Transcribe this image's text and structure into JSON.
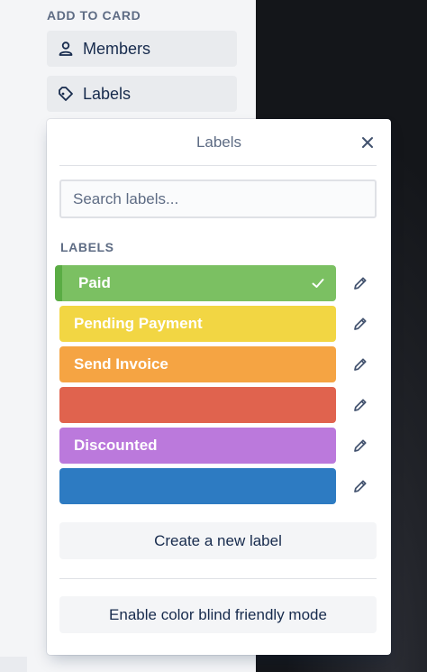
{
  "sidebar": {
    "section_title": "ADD TO CARD",
    "members_label": "Members",
    "members_icon": "person-icon",
    "labels_label": "Labels",
    "labels_icon": "tag-icon"
  },
  "popover": {
    "title": "Labels",
    "close_icon": "close-icon",
    "search_placeholder": "Search labels...",
    "section_heading": "LABELS",
    "labels": [
      {
        "name": "Paid",
        "color": "#7bc062",
        "selected": true
      },
      {
        "name": "Pending Payment",
        "color": "#f2d643",
        "selected": false
      },
      {
        "name": "Send Invoice",
        "color": "#f5a443",
        "selected": false
      },
      {
        "name": "",
        "color": "#e0634e",
        "selected": false
      },
      {
        "name": "Discounted",
        "color": "#bb79dc",
        "selected": false
      },
      {
        "name": "",
        "color": "#2d7bc2",
        "selected": false
      }
    ],
    "create_label": "Create a new label",
    "colorblind_label": "Enable color blind friendly mode"
  },
  "colors": {
    "accent_paid_edge": "#5aac44",
    "text_muted": "#5e6c84",
    "text_primary": "#172b4d"
  }
}
